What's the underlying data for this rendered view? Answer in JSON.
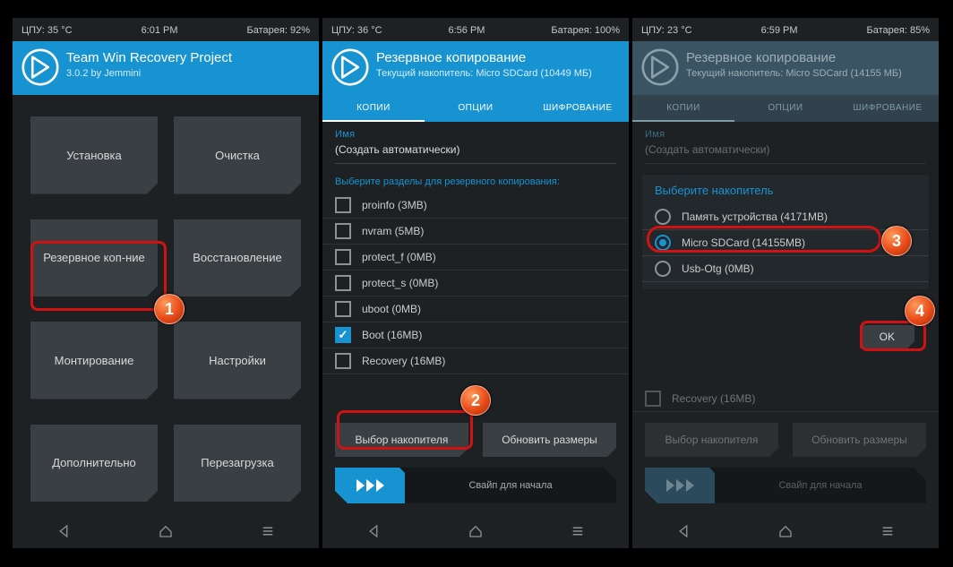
{
  "s1": {
    "status": {
      "cpu": "ЦПУ: 35 °C",
      "time": "6:01 PM",
      "bat": "Батарея: 92%"
    },
    "title": "Team Win Recovery Project",
    "subtitle": "3.0.2 by Jemmini",
    "tiles": [
      "Установка",
      "Очистка",
      "Резервное коп-ние",
      "Восстановление",
      "Монтирование",
      "Настройки",
      "Дополнительно",
      "Перезагрузка"
    ]
  },
  "s2": {
    "status": {
      "cpu": "ЦПУ: 36 °C",
      "time": "6:56 PM",
      "bat": "Батарея: 100%"
    },
    "title": "Резервное копирование",
    "subtitle": "Текущий накопитель: Micro SDCard (10449 МБ)",
    "tabs": [
      "КОПИИ",
      "ОПЦИИ",
      "ШИФРОВАНИЕ"
    ],
    "name_label": "Имя",
    "name_value": "(Создать автоматически)",
    "partitions_label": "Выберите разделы для резервного копирования:",
    "partitions": [
      {
        "label": "proinfo (3MB)",
        "checked": false
      },
      {
        "label": "nvram (5MB)",
        "checked": false
      },
      {
        "label": "protect_f (0MB)",
        "checked": false
      },
      {
        "label": "protect_s (0MB)",
        "checked": false
      },
      {
        "label": "uboot (0MB)",
        "checked": false
      },
      {
        "label": "Boot (16MB)",
        "checked": true
      },
      {
        "label": "Recovery (16MB)",
        "checked": false
      }
    ],
    "btn_storage": "Выбор накопителя",
    "btn_refresh": "Обновить размеры",
    "swipe": "Свайп для начала"
  },
  "s3": {
    "status": {
      "cpu": "ЦПУ: 23 °C",
      "time": "6:59 PM",
      "bat": "Батарея: 85%"
    },
    "title": "Резервное копирование",
    "subtitle": "Текущий накопитель: Micro SDCard (14155 МБ)",
    "tabs": [
      "КОПИИ",
      "ОПЦИИ",
      "ШИФРОВАНИЕ"
    ],
    "name_label": "Имя",
    "name_value": "(Создать автоматически)",
    "dialog_title": "Выберите накопитель",
    "storages": [
      {
        "label": "Память устройства (4171MB)",
        "selected": false
      },
      {
        "label": "Micro SDCard (14155MB)",
        "selected": true
      },
      {
        "label": "Usb-Otg (0MB)",
        "selected": false
      }
    ],
    "ok": "OK",
    "recovery_row": "Recovery (16MB)",
    "btn_storage": "Выбор накопителя",
    "btn_refresh": "Обновить размеры",
    "swipe": "Свайп для начала"
  },
  "callouts": {
    "1": "1",
    "2": "2",
    "3": "3",
    "4": "4"
  }
}
